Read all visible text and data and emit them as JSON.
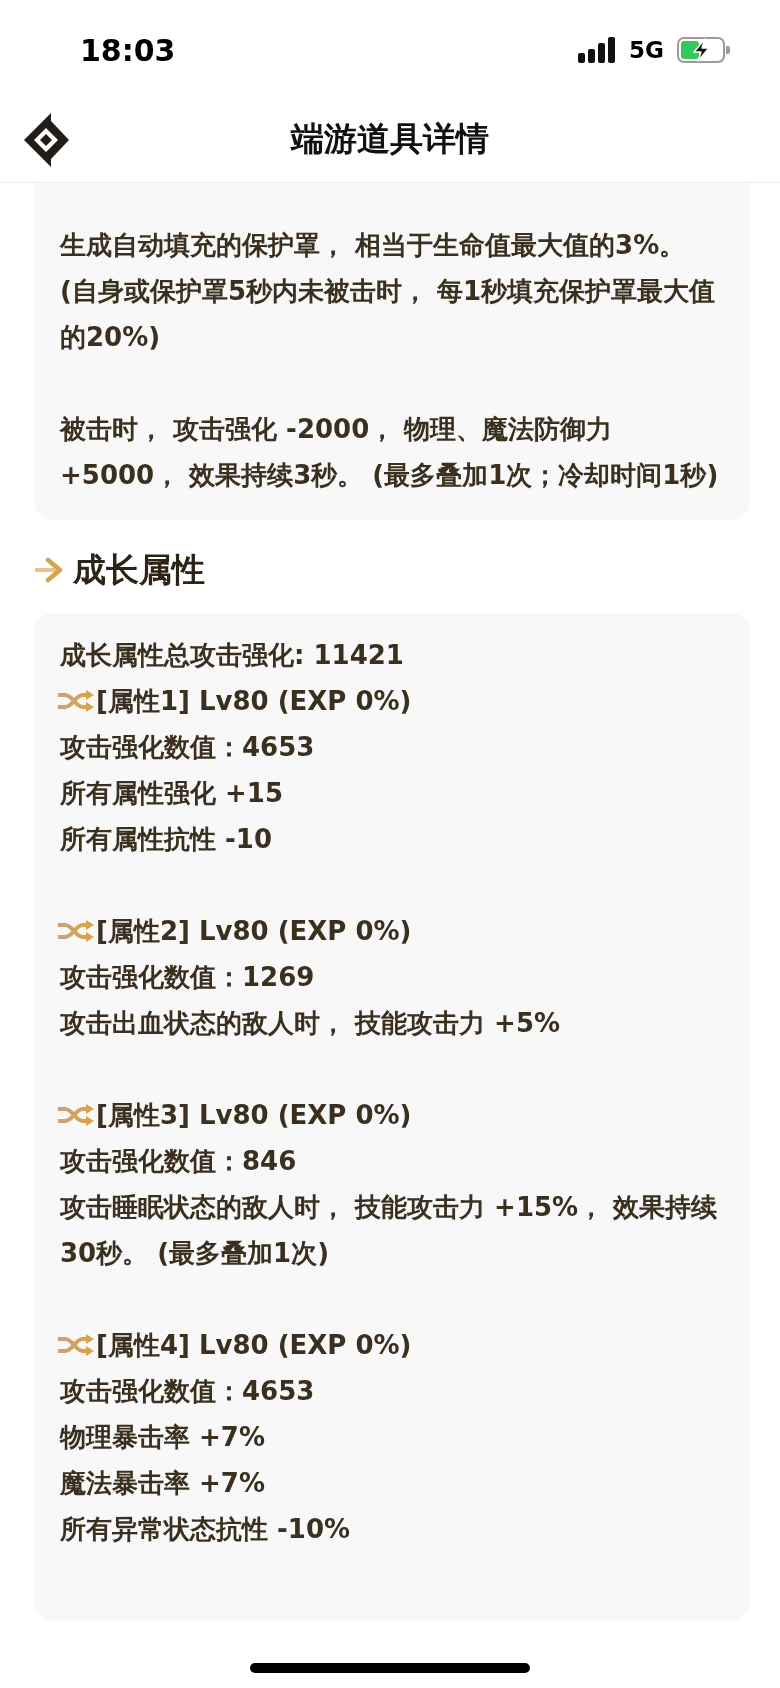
{
  "status_bar": {
    "time": "18:03",
    "network": "5G"
  },
  "header": {
    "title": "端游道具详情"
  },
  "effect_card": {
    "blocks": [
      {
        "lines": [
          "生成自动填充的保护罩， 相当于生命值最大值的3%。",
          "(自身或保护罩5秒内未被击时， 每1秒填充保护罩最大值的20%)"
        ]
      },
      {
        "lines": [
          "被击时， 攻击强化 -2000， 物理、魔法防御力 +5000， 效果持续3秒。 (最多叠加1次；冷却时间1秒)"
        ]
      }
    ]
  },
  "growth_section": {
    "title": "成长属性",
    "total": "成长属性总攻击强化: 11421",
    "attributes": [
      {
        "header": "[属性1] Lv80 (EXP 0%)",
        "lines": [
          "攻击强化数值：4653",
          "所有属性强化 +15",
          "所有属性抗性 -10"
        ]
      },
      {
        "header": "[属性2] Lv80 (EXP 0%)",
        "lines": [
          "攻击强化数值：1269",
          "攻击出血状态的敌人时， 技能攻击力 +5%"
        ]
      },
      {
        "header": "[属性3] Lv80 (EXP 0%)",
        "lines": [
          "攻击强化数值：846",
          "攻击睡眠状态的敌人时， 技能攻击力 +15%， 效果持续30秒。 (最多叠加1次)"
        ]
      },
      {
        "header": "[属性4] Lv80 (EXP 0%)",
        "lines": [
          "攻击强化数值：4653",
          "物理暴击率 +7%",
          "魔法暴击率 +7%",
          "所有异常状态抗性 -10%"
        ]
      }
    ]
  }
}
